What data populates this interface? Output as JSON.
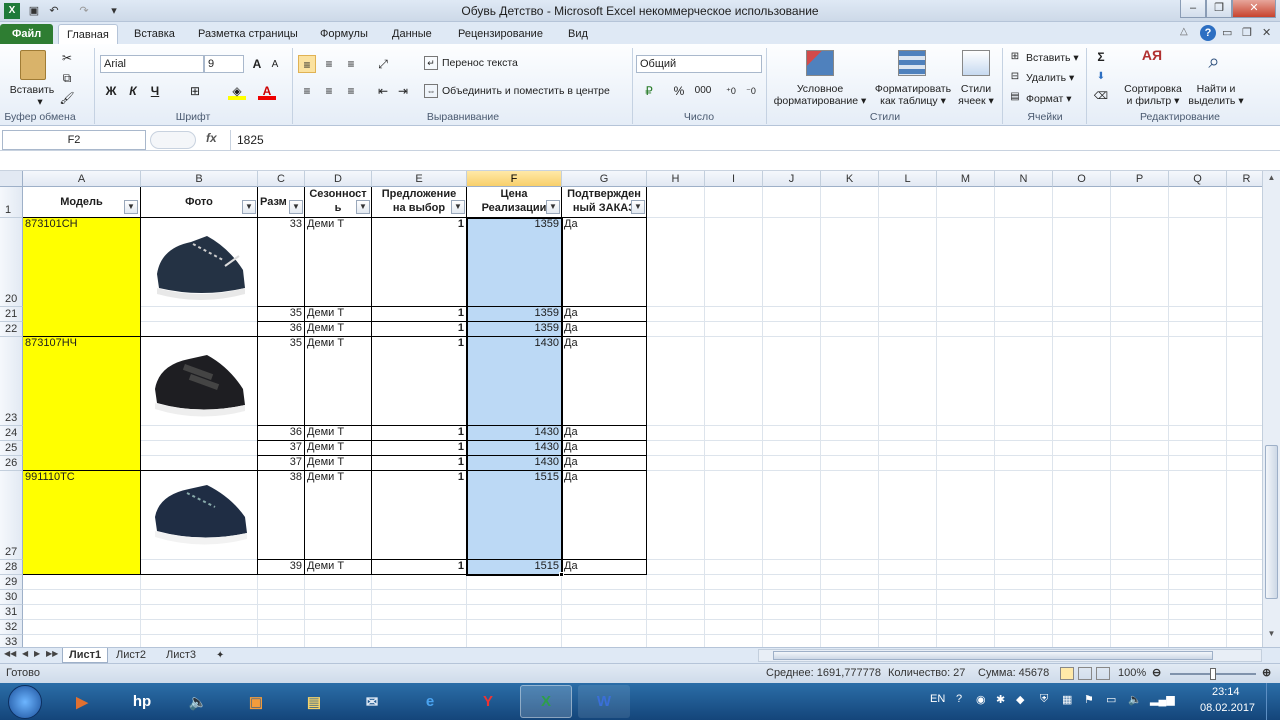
{
  "window": {
    "title": "Обувь Детство  -  Microsoft Excel некоммерческое использование"
  },
  "tabs": [
    {
      "label": "Файл"
    },
    {
      "label": "Главная"
    },
    {
      "label": "Вставка"
    },
    {
      "label": "Разметка страницы"
    },
    {
      "label": "Формулы"
    },
    {
      "label": "Данные"
    },
    {
      "label": "Рецензирование"
    },
    {
      "label": "Вид"
    }
  ],
  "ribbon": {
    "paste": "Вставить",
    "font_name": "Arial",
    "font_size": "9",
    "bold": "Ж",
    "italic": "К",
    "underline": "Ч",
    "wrap_text": "Перенос текста",
    "merge_center": "Объединить и поместить в центре",
    "number_format": "Общий",
    "percent": "%",
    "thousands": "000",
    "cond_format": [
      "Условное",
      "форматирование"
    ],
    "format_table": [
      "Форматировать",
      "как таблицу"
    ],
    "cell_styles": [
      "Стили",
      "ячеек"
    ],
    "insert": "Вставить",
    "delete": "Удалить",
    "format": "Формат",
    "sort_filter": [
      "Сортировка",
      "и фильтр"
    ],
    "find_select": [
      "Найти и",
      "выделить"
    ],
    "groups": {
      "clipboard": "Буфер обмена",
      "font": "Шрифт",
      "alignment": "Выравнивание",
      "number": "Число",
      "styles": "Стили",
      "cells": "Ячейки",
      "editing": "Редактирование"
    }
  },
  "formula_bar": {
    "name_box": "F2",
    "fx": "fx",
    "value": "1825"
  },
  "columns": [
    "A",
    "B",
    "C",
    "D",
    "E",
    "F",
    "G",
    "H",
    "I",
    "J",
    "K",
    "L",
    "M",
    "N",
    "O",
    "P",
    "Q",
    "R"
  ],
  "headers": {
    "model": "Модель",
    "photo": "Фото",
    "size": "Разм",
    "season": [
      "Сезонност",
      "ь"
    ],
    "offer": [
      "Предложение",
      "на выбор"
    ],
    "price": [
      "Цена",
      "Реализации"
    ],
    "confirmed": [
      "Подтвержден",
      "ный ЗАКАЗ"
    ]
  },
  "rows": [
    {
      "n": "20",
      "model": "873101СН",
      "size": "33",
      "season": "Деми Т",
      "offer": "1",
      "price": "1359",
      "conf": "Да"
    },
    {
      "n": "21",
      "model": "",
      "size": "35",
      "season": "Деми Т",
      "offer": "1",
      "price": "1359",
      "conf": "Да"
    },
    {
      "n": "22",
      "model": "",
      "size": "36",
      "season": "Деми Т",
      "offer": "1",
      "price": "1359",
      "conf": "Да"
    },
    {
      "n": "23",
      "model": "873107НЧ",
      "size": "35",
      "season": "Деми Т",
      "offer": "1",
      "price": "1430",
      "conf": "Да"
    },
    {
      "n": "24",
      "model": "",
      "size": "36",
      "season": "Деми Т",
      "offer": "1",
      "price": "1430",
      "conf": "Да"
    },
    {
      "n": "25",
      "model": "",
      "size": "37",
      "season": "Деми Т",
      "offer": "1",
      "price": "1430",
      "conf": "Да"
    },
    {
      "n": "26",
      "model": "",
      "size": "37",
      "season": "Деми Т",
      "offer": "1",
      "price": "1430",
      "conf": "Да"
    },
    {
      "n": "27",
      "model": "991110ТС",
      "size": "38",
      "season": "Деми Т",
      "offer": "1",
      "price": "1515",
      "conf": "Да"
    },
    {
      "n": "28",
      "model": "",
      "size": "39",
      "season": "Деми Т",
      "offer": "1",
      "price": "1515",
      "conf": "Да"
    }
  ],
  "empty_rows": [
    "29",
    "30",
    "31",
    "32",
    "33"
  ],
  "header_row_num": "1",
  "sheets": [
    "Лист1",
    "Лист2",
    "Лист3"
  ],
  "status": {
    "ready": "Готово",
    "average": "Среднее: 1691,777778",
    "count": "Количество: 27",
    "sum": "Сумма: 45678",
    "zoom": "100%"
  },
  "taskbar": {
    "lang": "EN",
    "time": "23:14",
    "date": "08.02.2017"
  },
  "colors": {
    "accent_green": "#2e7d32",
    "highlight_yellow": "#ffff00",
    "selection_blue": "#bcd9f5"
  }
}
